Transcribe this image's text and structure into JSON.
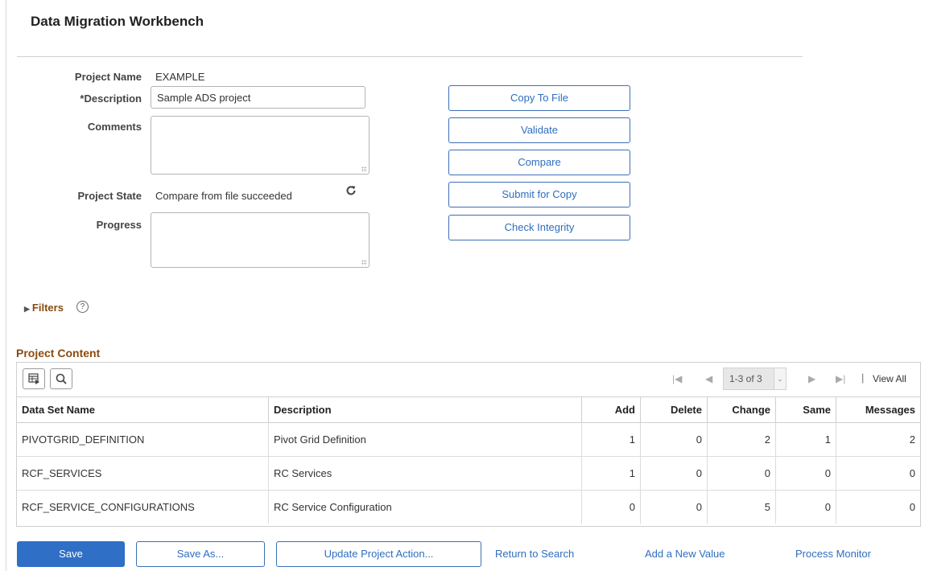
{
  "page": {
    "title": "Data Migration Workbench"
  },
  "form": {
    "project_name_label": "Project Name",
    "project_name_value": "EXAMPLE",
    "description_label": "*Description",
    "description_value": "Sample ADS project",
    "comments_label": "Comments",
    "comments_value": "",
    "project_state_label": "Project State",
    "project_state_value": "Compare from file succeeded",
    "progress_label": "Progress",
    "progress_value": ""
  },
  "actions": {
    "copy_to_file": "Copy To File",
    "validate": "Validate",
    "compare": "Compare",
    "submit_for_copy": "Submit for Copy",
    "check_integrity": "Check Integrity"
  },
  "filters": {
    "label": "Filters",
    "help": "?"
  },
  "project_content": {
    "title": "Project Content",
    "pager": {
      "range": "1-3 of 3",
      "view_all": "View All"
    },
    "columns": [
      "Data Set Name",
      "Description",
      "Add",
      "Delete",
      "Change",
      "Same",
      "Messages"
    ],
    "rows": [
      {
        "name": "PIVOTGRID_DEFINITION",
        "description": "Pivot Grid Definition",
        "add": "1",
        "delete": "0",
        "change": "2",
        "same": "1",
        "messages": "2"
      },
      {
        "name": "RCF_SERVICES",
        "description": "RC Services",
        "add": "1",
        "delete": "0",
        "change": "0",
        "same": "0",
        "messages": "0"
      },
      {
        "name": "RCF_SERVICE_CONFIGURATIONS",
        "description": "RC Service Configuration",
        "add": "0",
        "delete": "0",
        "change": "5",
        "same": "0",
        "messages": "0"
      }
    ]
  },
  "footer": {
    "save": "Save",
    "save_as": "Save As...",
    "update_project_action": "Update Project Action...",
    "return_to_search": "Return to Search",
    "add_new_value": "Add a New Value",
    "process_monitor": "Process Monitor"
  },
  "colors": {
    "link": "#2f6ebf",
    "section_title": "#8a4b0f",
    "primary_button": "#2f6fc6"
  }
}
